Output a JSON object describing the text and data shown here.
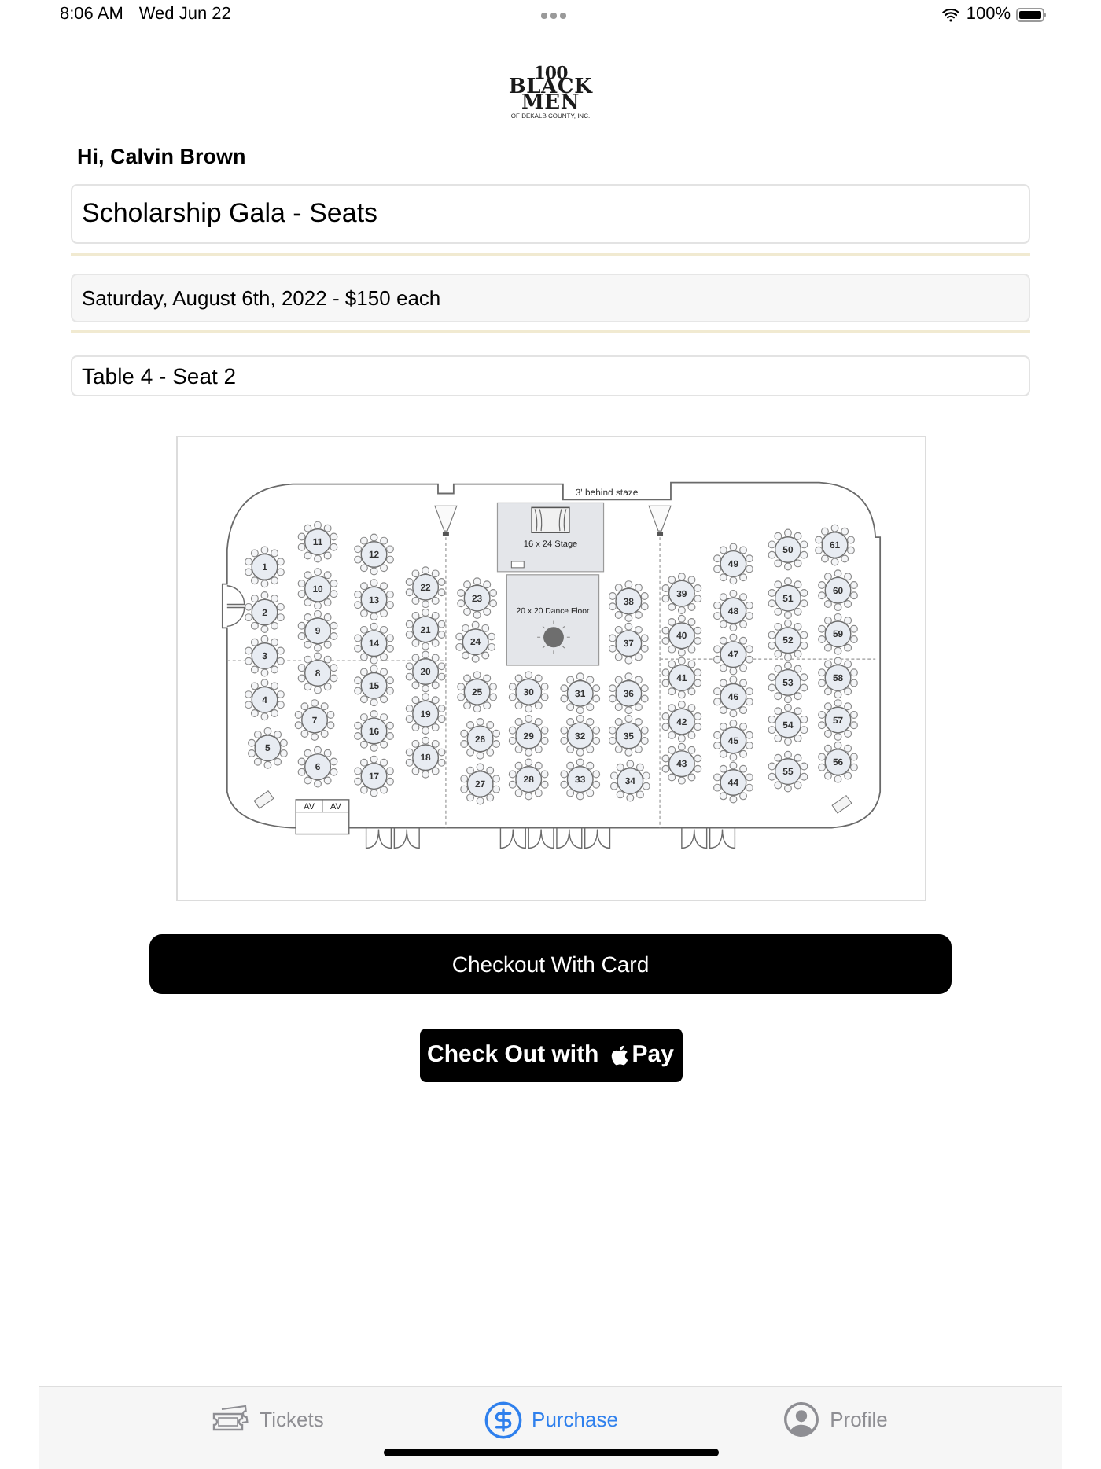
{
  "status_bar": {
    "time": "8:06 AM",
    "date": "Wed Jun 22",
    "battery": "100%"
  },
  "logo": {
    "number": "100",
    "words": [
      "BLACK",
      "MEN"
    ],
    "tagline": "OF DEKALB COUNTY, INC."
  },
  "greeting": "Hi, Calvin Brown",
  "event_title": "Scholarship Gala - Seats",
  "event_date": "Saturday, August 6th, 2022 - $150 each",
  "seat_field": {
    "value": "Table 4 - Seat 2"
  },
  "floor_plan": {
    "clearance_note": "3' behind staze",
    "stage_label": "16 x 24 Stage",
    "dance_floor_label": "20 x 20 Dance Floor",
    "av_labels": [
      "AV",
      "AV"
    ],
    "tables": [
      "1",
      "2",
      "3",
      "4",
      "5",
      "11",
      "10",
      "9",
      "8",
      "7",
      "6",
      "12",
      "13",
      "14",
      "15",
      "16",
      "17",
      "22",
      "21",
      "20",
      "19",
      "18",
      "23",
      "24",
      "25",
      "26",
      "27",
      "30",
      "29",
      "28",
      "31",
      "32",
      "33",
      "38",
      "37",
      "36",
      "35",
      "34",
      "39",
      "40",
      "41",
      "42",
      "43",
      "49",
      "48",
      "47",
      "46",
      "45",
      "44",
      "50",
      "51",
      "52",
      "53",
      "54",
      "55",
      "61",
      "60",
      "59",
      "58",
      "57",
      "56"
    ]
  },
  "buttons": {
    "card_checkout": "Checkout With Card",
    "apple_pay": {
      "before_logo": "Check Out with",
      "after_logo": "Pay"
    }
  },
  "tabs": [
    {
      "label": "Tickets",
      "selected": false
    },
    {
      "label": "Purchase",
      "selected": true
    },
    {
      "label": "Profile",
      "selected": false
    }
  ]
}
